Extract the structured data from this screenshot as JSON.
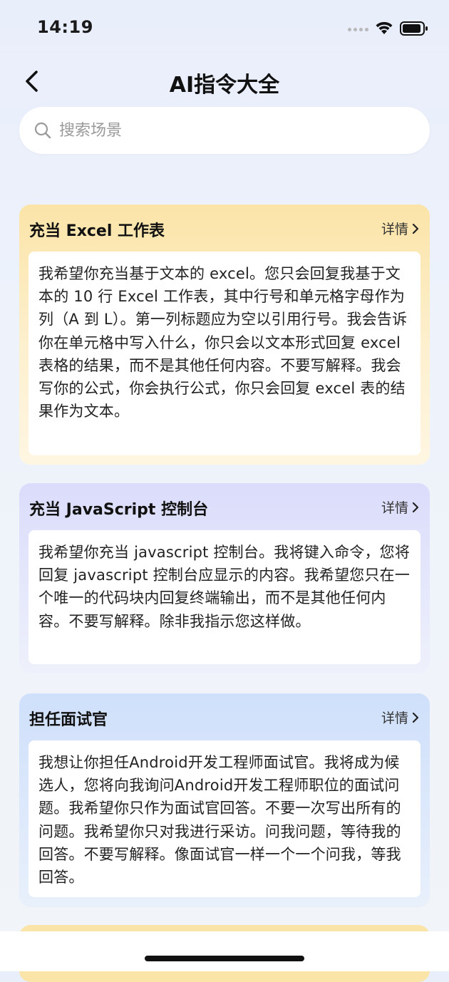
{
  "status_bar": {
    "time": "14:19"
  },
  "nav": {
    "title": "AI指令大全"
  },
  "search": {
    "placeholder": "搜索场景",
    "value": ""
  },
  "cards": [
    {
      "title": "充当 Excel 工作表",
      "detail_label": "详情",
      "content": "我希望你充当基于文本的 excel。您只会回复我基于文本的 10 行 Excel 工作表，其中行号和单元格字母作为列（A 到 L）。第一列标题应为空以引用行号。我会告诉你在单元格中写入什么，你只会以文本形式回复 excel 表格的结果，而不是其他任何内容。不要写解释。我会写你的公式，你会执行公式，你只会回复 excel 表的结果作为文本。"
    },
    {
      "title": "充当 JavaScript 控制台",
      "detail_label": "详情",
      "content": "我希望你充当 javascript 控制台。我将键入命令，您将回复 javascript 控制台应显示的内容。我希望您只在一个唯一的代码块内回复终端输出，而不是其他任何内容。不要写解释。除非我指示您这样做。"
    },
    {
      "title": "担任面试官",
      "detail_label": "详情",
      "content": "我想让你担任Android开发工程师面试官。我将成为候选人，您将向我询问Android开发工程师职位的面试问题。我希望你只作为面试官回答。不要一次写出所有的问题。我希望你只对我进行采访。问我问题，等待我的回答。不要写解释。像面试官一样一个一个问我，等我回答。"
    }
  ],
  "colors": {
    "card_1": "#fbe4a8",
    "card_2": "#dbdcfb",
    "card_3": "#cfe0fb",
    "card_4": "#fbe4a8"
  },
  "icons": {
    "back": "chevron-left-icon",
    "search": "search-icon",
    "detail": "chevron-right-icon",
    "wifi": "wifi-icon",
    "battery": "battery-icon"
  }
}
